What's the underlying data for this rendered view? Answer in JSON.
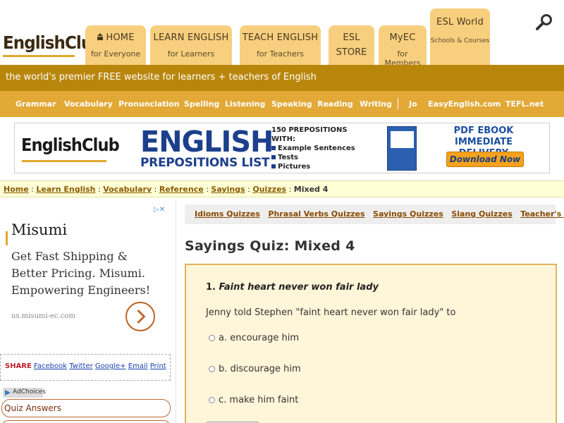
{
  "header": {
    "logo": "EnglishClub",
    "tabs": [
      {
        "label": "HOME",
        "sub": "for Everyone"
      },
      {
        "label": "LEARN ENGLISH",
        "sub": "for Learners"
      },
      {
        "label": "TEACH ENGLISH",
        "sub": "for Teachers"
      },
      {
        "label": "ESL",
        "sub": "STORE"
      },
      {
        "label": "MyEC",
        "sub": "for Members"
      },
      {
        "label": "ESL World",
        "sub": "Schools & Courses"
      }
    ],
    "search_icon": "search-icon"
  },
  "tagline": "the world's premier FREE website for learners + teachers of English",
  "topic_nav": [
    "Grammar",
    "Vocabulary",
    "Pronunciation",
    "Spelling",
    "Listening",
    "Speaking",
    "Reading",
    "Writing",
    "Jo",
    "EasyEnglish.com",
    "TEFL.net"
  ],
  "banner": {
    "logo": "EnglishClub",
    "title1": "ENGLISH",
    "title2": "PREPOSITIONS LIST",
    "list_head1": "150 PREPOSITIONS",
    "list_head2": "WITH:",
    "list_items": [
      "Example Sentences",
      "Tests",
      "Pictures"
    ],
    "ebook1": "PDF EBOOK",
    "ebook2": "IMMEDIATE DELIVERY",
    "button": "Download Now"
  },
  "breadcrumb": {
    "items": [
      "Home",
      "Learn English",
      "Vocabulary",
      "Reference",
      "Sayings",
      "Quizzes"
    ],
    "current": "Mixed 4"
  },
  "sidebar": {
    "ad_title": "Misumi",
    "ad_text": "Get Fast Shipping & Better Pricing. Misumi. Empowering Engineers!",
    "ad_url": "us.misumi-ec.com",
    "share_label": "SHARE",
    "share_links": [
      "Facebook",
      "Twitter",
      "Google+",
      "Email",
      "Print"
    ],
    "adchoices": "AdChoices",
    "quiz_answers": "Quiz Answers"
  },
  "subnav": [
    "Idioms Quizzes",
    "Phrasal Verbs Quizzes",
    "Sayings Quizzes",
    "Slang Quizzes",
    "Teacher's Notes"
  ],
  "page_title": "Sayings Quiz: Mixed 4",
  "quiz": {
    "number": "1.",
    "saying": "Faint heart never won fair lady",
    "question": "Jenny told Stephen \"faint heart never won fair lady\" to",
    "options": [
      "a. encourage him",
      "b. discourage him",
      "c. make him faint"
    ]
  },
  "colors": {
    "tab": "#f7cf7e",
    "tagline_bar": "#b8860b",
    "topic_bar": "#e2a937",
    "breadcrumb_bg": "#ffffd6",
    "quiz_bg": "#fff5d9",
    "banner_blue": "#1c3f8c"
  }
}
